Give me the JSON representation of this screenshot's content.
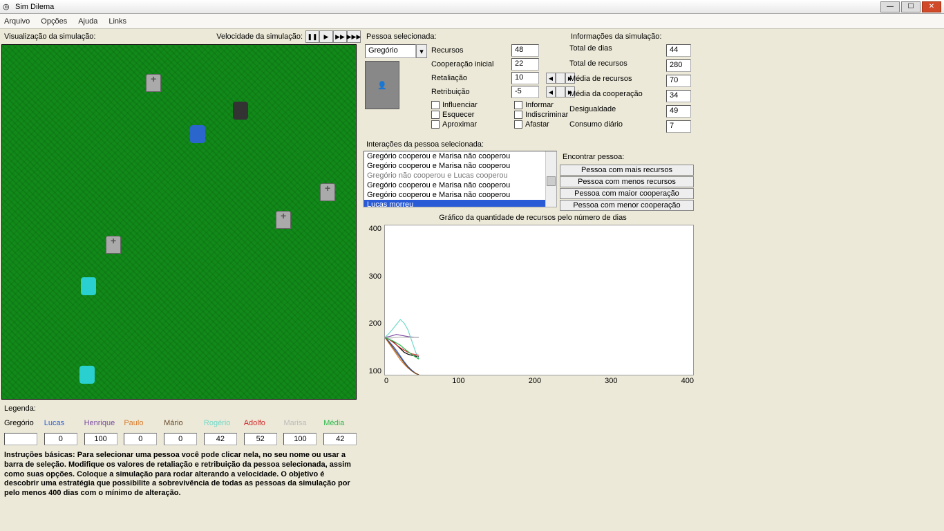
{
  "window": {
    "title": "Sim Dilema"
  },
  "menu": {
    "arquivo": "Arquivo",
    "opcoes": "Opções",
    "ajuda": "Ajuda",
    "links": "Links"
  },
  "viz": {
    "label": "Visualização da simulação:"
  },
  "speed": {
    "label": "Velocidade da simulação:"
  },
  "person_panel": {
    "header": "Pessoa selecionada:",
    "selected": "Gregório",
    "fields": {
      "recursos_l": "Recursos",
      "recursos_v": "48",
      "coop_l": "Cooperação inicial",
      "coop_v": "22",
      "retal_l": "Retaliação",
      "retal_v": "10",
      "retrib_l": "Retribuição",
      "retrib_v": "-5"
    },
    "checks": {
      "influenciar": "Influenciar",
      "informar": "Informar",
      "esquecer": "Esquecer",
      "indiscriminar": "Indiscriminar",
      "aproximar": "Aproximar",
      "afastar": "Afastar"
    }
  },
  "siminfo": {
    "header": "Informações da simulação:",
    "rows": {
      "dias_l": "Total de dias",
      "dias_v": "44",
      "rec_l": "Total de recursos",
      "rec_v": "280",
      "mrec_l": "Média de recursos",
      "mrec_v": "70",
      "mcoop_l": "Média da cooperação",
      "mcoop_v": "34",
      "desig_l": "Desigualdade",
      "desig_v": "49",
      "cons_l": "Consumo diário",
      "cons_v": "7"
    }
  },
  "interactions": {
    "header": "Interações da pessoa selecionada:",
    "items": [
      "Gregório cooperou e Marisa não cooperou",
      "Gregório cooperou e Marisa não cooperou",
      "Gregório não cooperou e Lucas cooperou",
      "Gregório cooperou e Marisa não cooperou",
      "Gregório cooperou e Marisa não cooperou",
      "Lucas morreu"
    ]
  },
  "find": {
    "header": "Encontrar pessoa:",
    "b1": "Pessoa com mais recursos",
    "b2": "Pessoa com menos recursos",
    "b3": "Pessoa com maior cooperação",
    "b4": "Pessoa com menor cooperação"
  },
  "legend": {
    "header": "Legenda:",
    "names": [
      "Gregório",
      "Lucas",
      "Henrique",
      "Paulo",
      "Mário",
      "Rogério",
      "Adolfo",
      "Marisa",
      "Média"
    ],
    "colors": [
      "#000000",
      "#2a5bd7",
      "#7a4aa0",
      "#d87a2a",
      "#6a4a2a",
      "#6fd9c9",
      "#d02a2a",
      "#bbbbbb",
      "#2ab84a"
    ],
    "values": [
      "",
      "0",
      "100",
      "0",
      "0",
      "42",
      "52",
      "100",
      "42"
    ]
  },
  "instructions": "Instruções básicas: Para selecionar uma pessoa você pode clicar nela, no seu nome ou usar a barra de seleção. Modifique os valores de retaliação e retribuição da pessoa selecionada, assim como suas opções. Coloque a simulação para rodar alterando a velocidade. O objetivo é descobrir uma estratégia que possibilite a sobrevivência de todas as pessoas da simulação por pelo menos 400 dias com o mínimo de alteração.",
  "chart": {
    "title": "Gráfico da quantidade de recursos pelo número de dias",
    "yticks": [
      "400",
      "300",
      "200",
      "100"
    ],
    "xticks": [
      "0",
      "100",
      "200",
      "300",
      "400"
    ]
  },
  "chart_data": {
    "type": "line",
    "title": "Gráfico da quantidade de recursos pelo número de dias",
    "xlabel": "",
    "ylabel": "",
    "xlim": [
      0,
      400
    ],
    "ylim": [
      0,
      400
    ],
    "x": [
      0,
      5,
      10,
      15,
      20,
      25,
      30,
      35,
      40,
      44
    ],
    "series": [
      {
        "name": "Gregório",
        "color": "#000000",
        "values": [
          100,
          95,
          90,
          80,
          70,
          60,
          55,
          52,
          50,
          48
        ]
      },
      {
        "name": "Lucas",
        "color": "#2a5bd7",
        "values": [
          100,
          90,
          78,
          65,
          50,
          35,
          22,
          12,
          4,
          0
        ]
      },
      {
        "name": "Henrique",
        "color": "#7a4aa0",
        "values": [
          100,
          102,
          105,
          108,
          106,
          104,
          102,
          101,
          100,
          100
        ]
      },
      {
        "name": "Paulo",
        "color": "#d87a2a",
        "values": [
          100,
          85,
          70,
          55,
          40,
          28,
          18,
          10,
          4,
          0
        ]
      },
      {
        "name": "Mário",
        "color": "#6a4a2a",
        "values": [
          100,
          88,
          74,
          60,
          46,
          32,
          20,
          10,
          3,
          0
        ]
      },
      {
        "name": "Rogério",
        "color": "#6fd9c9",
        "values": [
          100,
          110,
          122,
          135,
          148,
          138,
          120,
          90,
          60,
          42
        ]
      },
      {
        "name": "Adolfo",
        "color": "#d02a2a",
        "values": [
          100,
          95,
          88,
          80,
          72,
          66,
          60,
          56,
          54,
          52
        ]
      },
      {
        "name": "Marisa",
        "color": "#bbbbbb",
        "values": [
          100,
          98,
          99,
          100,
          101,
          100,
          100,
          100,
          100,
          100
        ]
      },
      {
        "name": "Média",
        "color": "#2ab84a",
        "values": [
          100,
          95,
          91,
          85,
          79,
          70,
          62,
          54,
          47,
          42
        ]
      }
    ]
  }
}
